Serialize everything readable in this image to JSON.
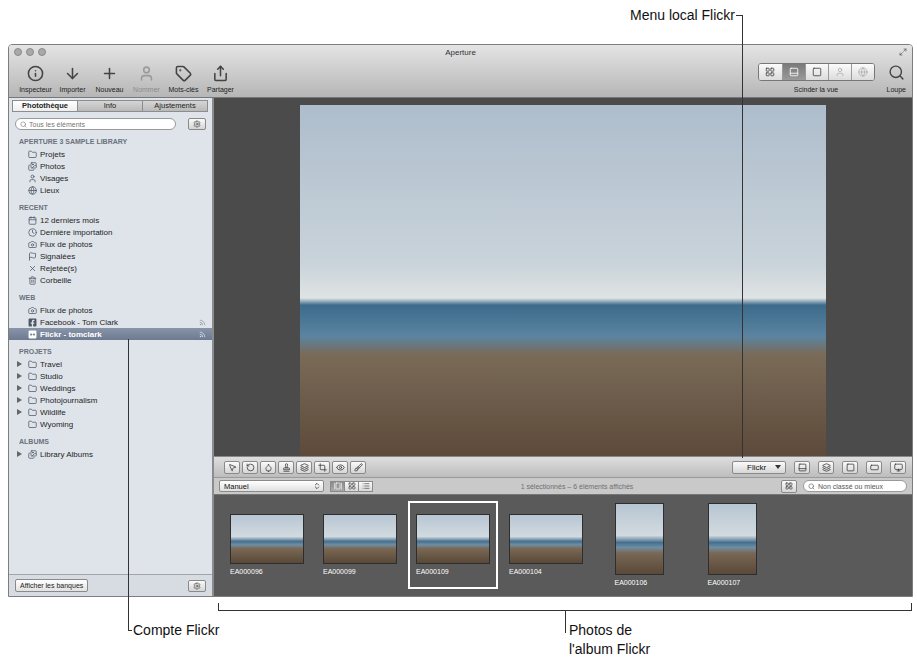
{
  "annotations": {
    "flickr_menu": "Menu local Flickr",
    "flickr_account": "Compte Flickr",
    "album_photos": [
      "Photos de",
      "l'album Flickr"
    ]
  },
  "window": {
    "title": "Aperture"
  },
  "toolbar": {
    "items": [
      {
        "label": "Inspecteur",
        "disabled": false
      },
      {
        "label": "Importer",
        "disabled": false
      },
      {
        "label": "Nouveau",
        "disabled": false
      },
      {
        "label": "Nommer",
        "disabled": true
      },
      {
        "label": "Mots-clés",
        "disabled": false
      },
      {
        "label": "Partager",
        "disabled": false
      }
    ],
    "view_buttons": [
      {
        "selected": false,
        "disabled": false
      },
      {
        "selected": true,
        "disabled": false
      },
      {
        "selected": false,
        "disabled": false
      },
      {
        "selected": false,
        "disabled": true
      },
      {
        "selected": false,
        "disabled": true
      }
    ],
    "view_label": "Scinder la vue",
    "loupe": "Loupe"
  },
  "sidebar": {
    "tabs": [
      {
        "label": "Photothèque",
        "selected": true
      },
      {
        "label": "Info",
        "selected": false
      },
      {
        "label": "Ajustements",
        "selected": false
      }
    ],
    "search": {
      "placeholder": "Tous les éléments"
    },
    "sections": [
      {
        "title": "APERTURE 3 SAMPLE LIBRARY",
        "items": [
          {
            "label": "Projets",
            "selected": false,
            "expandable": false,
            "published": false
          },
          {
            "label": "Photos",
            "selected": false,
            "expandable": false,
            "published": false
          },
          {
            "label": "Visages",
            "selected": false,
            "expandable": false,
            "published": false
          },
          {
            "label": "Lieux",
            "selected": false,
            "expandable": false,
            "published": false
          }
        ]
      },
      {
        "title": "RECENT",
        "items": [
          {
            "label": "12 derniers mois",
            "selected": false,
            "expandable": false,
            "published": false
          },
          {
            "label": "Dernière importation",
            "selected": false,
            "expandable": false,
            "published": false
          },
          {
            "label": "Flux de photos",
            "selected": false,
            "expandable": false,
            "published": false
          },
          {
            "label": "Signalées",
            "selected": false,
            "expandable": false,
            "published": false
          },
          {
            "label": "Rejetée(s)",
            "selected": false,
            "expandable": false,
            "published": false
          },
          {
            "label": "Corbeille",
            "selected": false,
            "expandable": false,
            "published": false
          }
        ]
      },
      {
        "title": "WEB",
        "items": [
          {
            "label": "Flux de photos",
            "selected": false,
            "expandable": false,
            "published": false
          },
          {
            "label": "Facebook - Tom Clark",
            "selected": false,
            "expandable": false,
            "published": true
          },
          {
            "label": "Flickr - tomclark",
            "selected": true,
            "expandable": false,
            "published": true
          }
        ]
      },
      {
        "title": "PROJETS",
        "items": [
          {
            "label": "Travel",
            "selected": false,
            "expandable": true,
            "published": false
          },
          {
            "label": "Studio",
            "selected": false,
            "expandable": true,
            "published": false
          },
          {
            "label": "Weddings",
            "selected": false,
            "expandable": true,
            "published": false
          },
          {
            "label": "Photojournalism",
            "selected": false,
            "expandable": true,
            "published": false
          },
          {
            "label": "Wildlife",
            "selected": false,
            "expandable": true,
            "published": false
          },
          {
            "label": "Wyoming",
            "selected": false,
            "expandable": false,
            "published": false
          }
        ]
      },
      {
        "title": "ALBUMS",
        "items": [
          {
            "label": "Library Albums",
            "selected": false,
            "expandable": true,
            "published": false
          }
        ]
      }
    ],
    "footer_button": "Afficher les banques"
  },
  "viewer": {
    "flickr_menu": "Flickr"
  },
  "browser": {
    "sort": "Manuel",
    "view_modes": [
      {
        "selected": true
      },
      {
        "selected": false
      },
      {
        "selected": false
      }
    ],
    "status": "1 sélectionnés – 6 éléments affichés",
    "filter": "Non classé ou mieux",
    "thumbnails": [
      {
        "label": "EA000096",
        "selected": false,
        "kind": "landscape"
      },
      {
        "label": "EA000099",
        "selected": false,
        "kind": "landscape"
      },
      {
        "label": "EA000109",
        "selected": true,
        "kind": "landscape"
      },
      {
        "label": "EA000104",
        "selected": false,
        "kind": "landscape"
      },
      {
        "label": "EA000106",
        "selected": false,
        "kind": "portrait"
      },
      {
        "label": "EA000107",
        "selected": false,
        "kind": "portrait"
      }
    ]
  }
}
